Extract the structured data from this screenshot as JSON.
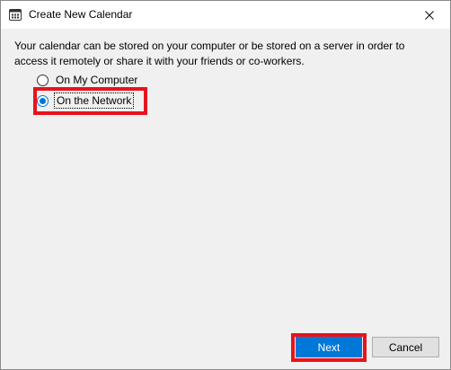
{
  "window": {
    "title": "Create New Calendar",
    "app_icon": "calendar-icon",
    "close_icon": "close-icon"
  },
  "dialog": {
    "description": "Your calendar can be stored on your computer or be stored on a server in order to access it remotely or share it with your friends or co-workers.",
    "options": [
      {
        "label": "On My Computer",
        "selected": false
      },
      {
        "label": "On the Network",
        "selected": true
      }
    ]
  },
  "buttons": {
    "next_label": "Next",
    "cancel_label": "Cancel"
  },
  "colors": {
    "accent": "#0078d7",
    "highlight": "#e8131d",
    "dialog_background": "#f0f0f0"
  }
}
